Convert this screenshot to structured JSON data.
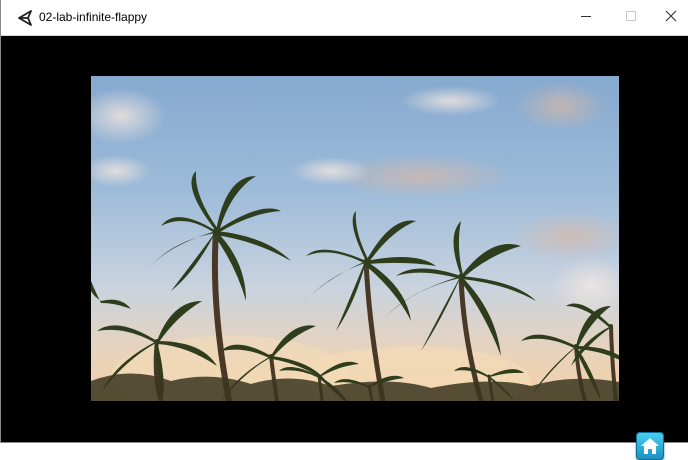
{
  "window": {
    "title": "02-lab-infinite-flappy",
    "app_icon": "unity-icon",
    "controls": {
      "minimize_icon": "minimize-icon",
      "maximize_icon": "maximize-icon",
      "close_icon": "close-icon"
    }
  },
  "game": {
    "background_color": "#000000",
    "scene_image": "palm-trees-sky-photo",
    "home_button_icon": "home-icon",
    "home_button_color": "#2fb2e0"
  }
}
